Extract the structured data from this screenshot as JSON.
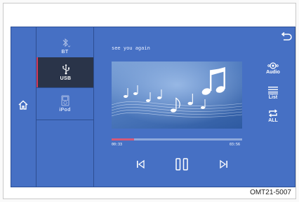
{
  "sources": [
    {
      "id": "bt",
      "label": "BT",
      "icon": "bluetooth-icon",
      "active": false
    },
    {
      "id": "usb",
      "label": "USB",
      "icon": "usb-icon",
      "active": true
    },
    {
      "id": "ipod",
      "label": "iPod",
      "icon": "ipod-icon",
      "active": false
    }
  ],
  "player": {
    "track_title": "see you again",
    "elapsed": "00:33",
    "duration": "03:56",
    "progress_fraction": 0.17
  },
  "side_controls": {
    "audio_label": "Audio",
    "list_label": "List",
    "repeat_label": "ALL"
  },
  "icons": {
    "home": "home-icon",
    "back": "back-icon",
    "previous": "previous-track-icon",
    "pause": "pause-icon",
    "next": "next-track-icon",
    "album_art": "music-note-icon"
  },
  "colors": {
    "screen_bg": "#4670c4",
    "active_bg": "#2a3449",
    "active_accent": "#d43a5a",
    "progress_fill": "#d4597a"
  },
  "figure_caption": "OMT21-5007"
}
